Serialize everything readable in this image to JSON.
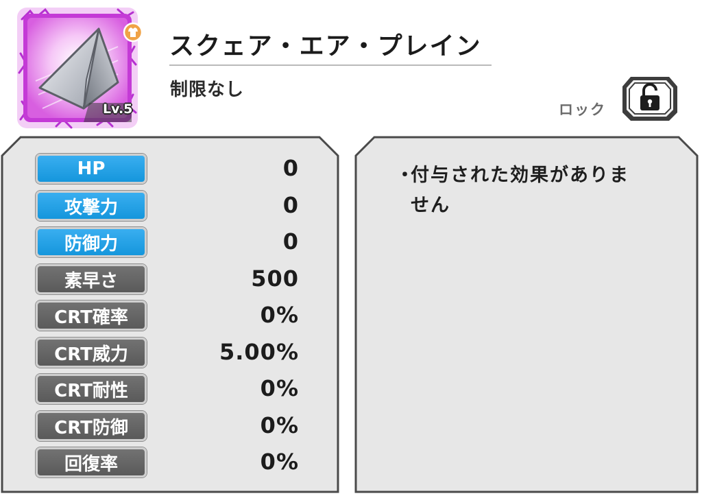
{
  "item": {
    "name": "スクェア・エア・プレイン",
    "level": "Lv.5",
    "restriction": "制限なし",
    "icon": "paper-plane-icon",
    "rarity_icon": "shirt-icon",
    "frame_color": "#c23dd6"
  },
  "lock": {
    "label": "ロック",
    "state": "unlocked",
    "icon": "unlocked-padlock-icon"
  },
  "stats": [
    {
      "label": "HP",
      "value": "0",
      "style": "blue"
    },
    {
      "label": "攻撃力",
      "value": "0",
      "style": "blue"
    },
    {
      "label": "防御力",
      "value": "0",
      "style": "blue"
    },
    {
      "label": "素早さ",
      "value": "500",
      "style": "gray"
    },
    {
      "label": "CRT確率",
      "value": "0%",
      "style": "gray"
    },
    {
      "label": "CRT威力",
      "value": "5.00%",
      "style": "gray"
    },
    {
      "label": "CRT耐性",
      "value": "0%",
      "style": "gray"
    },
    {
      "label": "CRT防御",
      "value": "0%",
      "style": "gray"
    },
    {
      "label": "回復率",
      "value": "0%",
      "style": "gray"
    }
  ],
  "effects": {
    "bullet": "・",
    "text": "付与された効果がありません"
  },
  "colors": {
    "stat_blue": "#1e9fe2",
    "stat_gray": "#626262",
    "panel_bg": "#e7e7e7"
  }
}
